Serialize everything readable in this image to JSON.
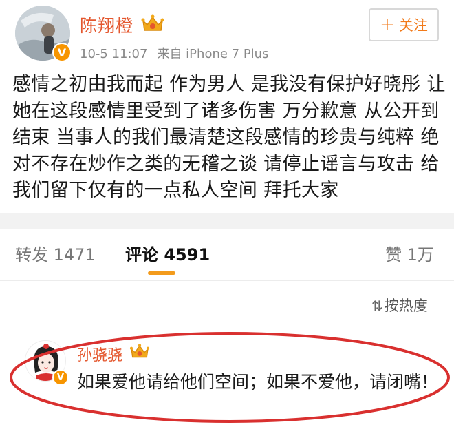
{
  "post": {
    "author": "陈翔橙",
    "timestamp": "10-5 11:07",
    "source": "来自 iPhone 7 Plus",
    "follow_label": "关注",
    "follow_icon": "+",
    "verified_badge": "V",
    "body": "感情之初由我而起 作为男人 是我没有保护好晓彤 让她在这段感情里受到了诸多伤害 万分歉意 从公开到结束 当事人的我们最清楚这段感情的珍贵与纯粹 绝对不存在炒作之类的无稽之谈 请停止谣言与攻击 给我们留下仅有的一点私人空间 拜托大家"
  },
  "tabs": {
    "repost_label": "转发",
    "repost_count": "1471",
    "comment_label": "评论",
    "comment_count": "4591",
    "like_label": "赞",
    "like_count": "1万"
  },
  "sort": {
    "icon": "⇅",
    "label": "按热度"
  },
  "comment": {
    "author": "孙骁骁",
    "verified_badge": "V",
    "text": "如果爱他请给他们空间；如果不爱他，请闭嘴！"
  },
  "colors": {
    "name": "#e4572e",
    "accent": "#f39b1c",
    "badge": "#f79500",
    "highlight": "#d9302f"
  }
}
